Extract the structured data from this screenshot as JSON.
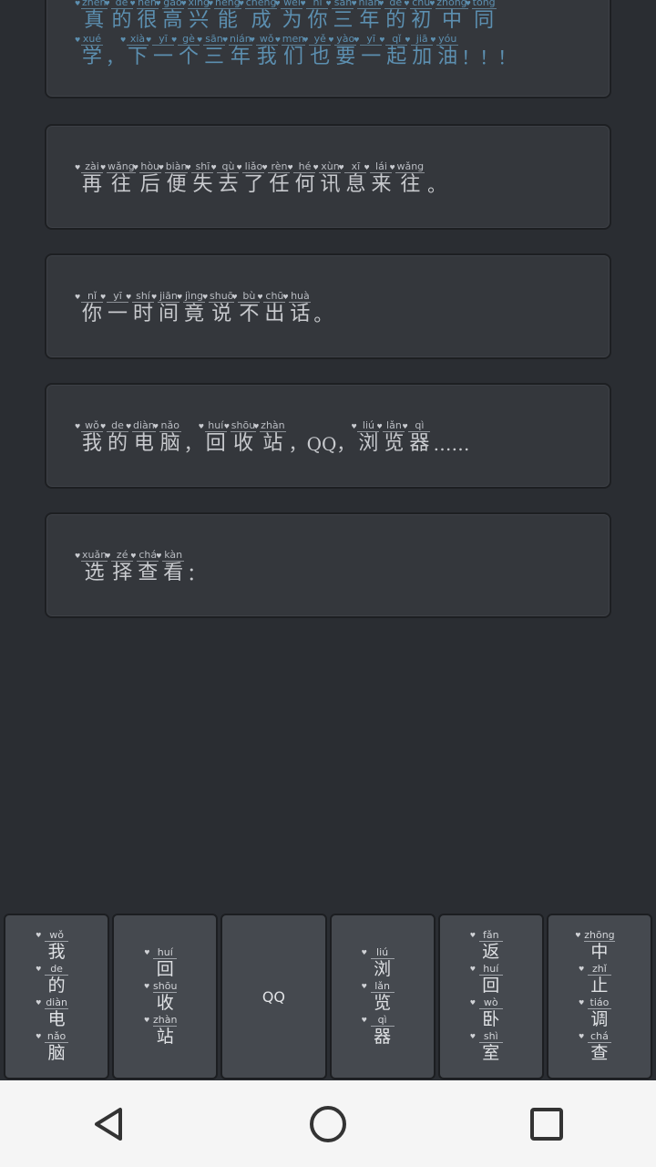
{
  "dialogs": [
    {
      "blue": true,
      "lines": [
        [
          {
            "py": "zhēn",
            "hz": "真"
          },
          {
            "py": "de",
            "hz": "的"
          },
          {
            "py": "hěn",
            "hz": "很"
          },
          {
            "py": "gāo",
            "hz": "高"
          },
          {
            "py": "xìng",
            "hz": "兴"
          },
          {
            "py": "néng",
            "hz": "能"
          },
          {
            "py": "chéng",
            "hz": "成"
          },
          {
            "py": "wéi",
            "hz": "为"
          },
          {
            "py": "nǐ",
            "hz": "你"
          },
          {
            "py": "sān",
            "hz": "三"
          },
          {
            "py": "nián",
            "hz": "年"
          },
          {
            "py": "de",
            "hz": "的"
          },
          {
            "py": "chū",
            "hz": "初"
          },
          {
            "py": "zhōng",
            "hz": "中"
          },
          {
            "py": "tóng",
            "hz": "同"
          }
        ],
        [
          {
            "py": "xué",
            "hz": "学"
          },
          {
            "p": "，"
          },
          {
            "py": "xià",
            "hz": "下"
          },
          {
            "py": "yī",
            "hz": "一"
          },
          {
            "py": "gè",
            "hz": "个"
          },
          {
            "py": "sān",
            "hz": "三"
          },
          {
            "py": "nián",
            "hz": "年"
          },
          {
            "py": "wǒ",
            "hz": "我"
          },
          {
            "py": "men",
            "hz": "们"
          },
          {
            "py": "yě",
            "hz": "也"
          },
          {
            "py": "yào",
            "hz": "要"
          },
          {
            "py": "yī",
            "hz": "一"
          },
          {
            "py": "qǐ",
            "hz": "起"
          },
          {
            "py": "jiā",
            "hz": "加"
          },
          {
            "py": "yóu",
            "hz": "油"
          },
          {
            "p": "！！！"
          }
        ]
      ]
    },
    {
      "lines": [
        [
          {
            "py": "zài",
            "hz": "再"
          },
          {
            "py": "wǎng",
            "hz": "往"
          },
          {
            "py": "hòu",
            "hz": "后"
          },
          {
            "py": "biàn",
            "hz": "便"
          },
          {
            "py": "shī",
            "hz": "失"
          },
          {
            "py": "qù",
            "hz": "去"
          },
          {
            "py": "liǎo",
            "hz": "了"
          },
          {
            "py": "rèn",
            "hz": "任"
          },
          {
            "py": "hé",
            "hz": "何"
          },
          {
            "py": "xùn",
            "hz": "讯"
          },
          {
            "py": "xī",
            "hz": "息"
          },
          {
            "py": "lái",
            "hz": "来"
          },
          {
            "py": "wǎng",
            "hz": "往"
          },
          {
            "p": "。"
          }
        ]
      ]
    },
    {
      "lines": [
        [
          {
            "py": "nǐ",
            "hz": "你"
          },
          {
            "py": "yī",
            "hz": "一"
          },
          {
            "py": "shí",
            "hz": "时"
          },
          {
            "py": "jiān",
            "hz": "间"
          },
          {
            "py": "jìng",
            "hz": "竟"
          },
          {
            "py": "shuō",
            "hz": "说"
          },
          {
            "py": "bù",
            "hz": "不"
          },
          {
            "py": "chū",
            "hz": "出"
          },
          {
            "py": "huà",
            "hz": "话"
          },
          {
            "p": "。"
          }
        ]
      ]
    },
    {
      "lines": [
        [
          {
            "py": "wǒ",
            "hz": "我"
          },
          {
            "py": "de",
            "hz": "的"
          },
          {
            "py": "diàn",
            "hz": "电"
          },
          {
            "py": "nǎo",
            "hz": "脑"
          },
          {
            "p": "，"
          },
          {
            "py": "huí",
            "hz": "回"
          },
          {
            "py": "shōu",
            "hz": "收"
          },
          {
            "py": "zhàn",
            "hz": "站"
          },
          {
            "p": "，QQ，"
          },
          {
            "py": "liú",
            "hz": "浏"
          },
          {
            "py": "lǎn",
            "hz": "览"
          },
          {
            "py": "qì",
            "hz": "器"
          },
          {
            "p": "……"
          }
        ]
      ]
    },
    {
      "lines": [
        [
          {
            "py": "xuǎn",
            "hz": "选"
          },
          {
            "py": "zé",
            "hz": "择"
          },
          {
            "py": "chá",
            "hz": "查"
          },
          {
            "py": "kàn",
            "hz": "看"
          },
          {
            "p": "："
          }
        ]
      ]
    }
  ],
  "choices": [
    {
      "name": "choice-my-computer",
      "units": [
        {
          "py": "wǒ",
          "hz": "我"
        },
        {
          "py": "de",
          "hz": "的"
        },
        {
          "py": "diàn",
          "hz": "电"
        },
        {
          "py": "nǎo",
          "hz": "脑"
        }
      ]
    },
    {
      "name": "choice-recycle-bin",
      "units": [
        {
          "py": "huí",
          "hz": "回"
        },
        {
          "py": "shōu",
          "hz": "收"
        },
        {
          "py": "zhàn",
          "hz": "站"
        }
      ]
    },
    {
      "name": "choice-qq",
      "text": "QQ"
    },
    {
      "name": "choice-browser",
      "units": [
        {
          "py": "liú",
          "hz": "浏"
        },
        {
          "py": "lǎn",
          "hz": "览"
        },
        {
          "py": "qì",
          "hz": "器"
        }
      ]
    },
    {
      "name": "choice-return-bedroom",
      "units": [
        {
          "py": "fǎn",
          "hz": "返"
        },
        {
          "py": "huí",
          "hz": "回"
        },
        {
          "py": "wò",
          "hz": "卧"
        },
        {
          "py": "shì",
          "hz": "室"
        }
      ]
    },
    {
      "name": "choice-stop-investigation",
      "units": [
        {
          "py": "zhōng",
          "hz": "中"
        },
        {
          "py": "zhǐ",
          "hz": "止"
        },
        {
          "py": "tiáo",
          "hz": "调"
        },
        {
          "py": "chá",
          "hz": "查"
        }
      ]
    }
  ],
  "navigation": {
    "back_icon": "triangle-back-icon",
    "home_icon": "circle-home-icon",
    "recents_icon": "square-recents-icon"
  }
}
